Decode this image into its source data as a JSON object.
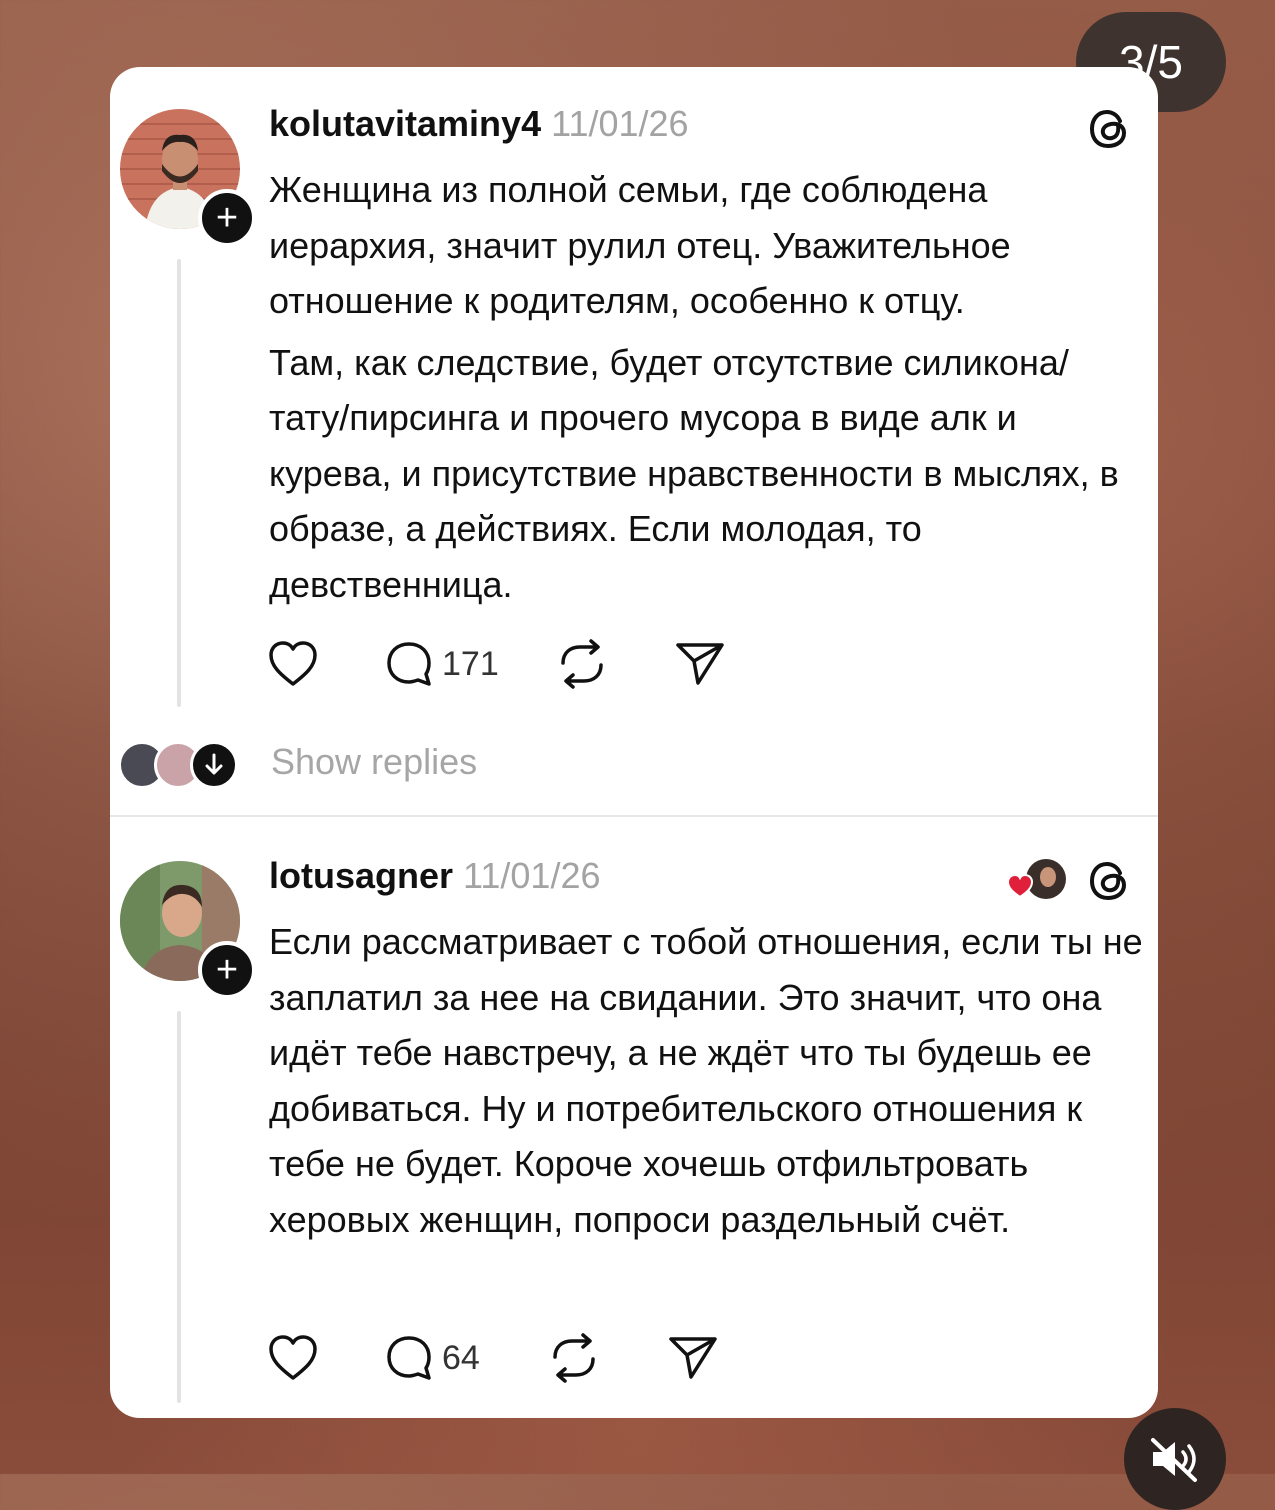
{
  "story": {
    "counter": "3/5"
  },
  "posts": [
    {
      "username": "kolutavitaminy4",
      "date": "11/01/26",
      "paragraphs": [
        "Женщина из полной семьи, где соблюдена иерархия, значит рулил отец. Уважительное отношение к родителям, особенно к отцу.",
        "Там, как следствие, будет отсутствие силикона/тату/пирсинга и прочего мусора в виде алк и курева, и присутствие нравственности в мыслях, в образе, а действиях. Если молодая, то девственница."
      ],
      "reply_count": "171",
      "show_replies": "Show replies"
    },
    {
      "username": "lotusagner",
      "date": "11/01/26",
      "paragraphs": [
        "Если рассматривает с тобой отношения, если ты не заплатил за нее на свидании. Это значит, что она идёт тебе навстречу, а не ждёт что ты будешь ее добиваться. Ну и потребительского отношения к тебе не будет. Короче хочешь отфильтровать херовых женщин, попроси раздельный счёт."
      ],
      "reply_count": "64"
    }
  ],
  "icons": {
    "like": "heart-icon",
    "reply": "comment-icon",
    "repost": "repost-icon",
    "share": "send-icon",
    "platform": "threads-icon",
    "mute": "speaker-muted-icon"
  },
  "colors": {
    "accent_heart": "#e0203a",
    "muted_text": "#a3a3a3"
  }
}
